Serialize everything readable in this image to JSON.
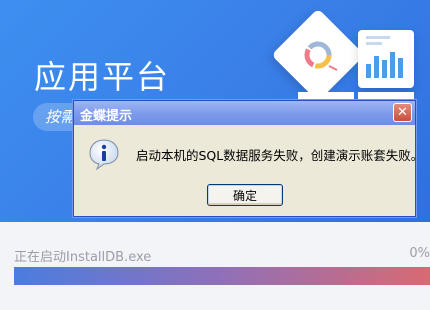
{
  "app": {
    "title": "应用平台",
    "pill_text": "按需"
  },
  "progress": {
    "label": "正在启动InstallDB.exe",
    "percent_text": "0%",
    "value": 0
  },
  "dialog": {
    "title": "金蝶提示",
    "close_symbol": "✕",
    "message": "启动本机的SQL数据服务失败，创建演示账套失败。",
    "ok_label": "确定"
  },
  "colors": {
    "banner": "#3a7fe8",
    "dialog_bg": "#ece9d8",
    "titlebar": "#7e9cec",
    "close": "#c8503c"
  },
  "icons": {
    "dialog_icon": "info-icon",
    "illustration_1": "pie-chart-icon",
    "illustration_2": "bar-chart-icon"
  }
}
